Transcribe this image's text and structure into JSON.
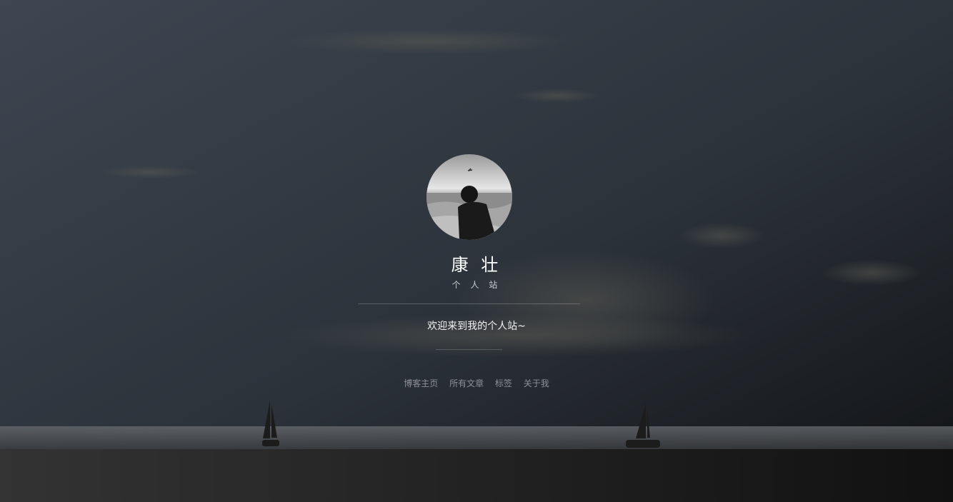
{
  "profile": {
    "name": "康 壮",
    "subtitle": "个 人 站",
    "welcome": "欢迎来到我的个人站~",
    "avatar_icon": "avatar-photo"
  },
  "nav": {
    "items": [
      {
        "label": "博客主页"
      },
      {
        "label": "所有文章"
      },
      {
        "label": "标签"
      },
      {
        "label": "关于我"
      }
    ]
  },
  "colors": {
    "sky_top": "#3d4652",
    "sky_bottom": "#1c1e22",
    "ground": "#2b2b2b",
    "text_primary": "#ffffff",
    "nav_text": "#8d9096"
  }
}
